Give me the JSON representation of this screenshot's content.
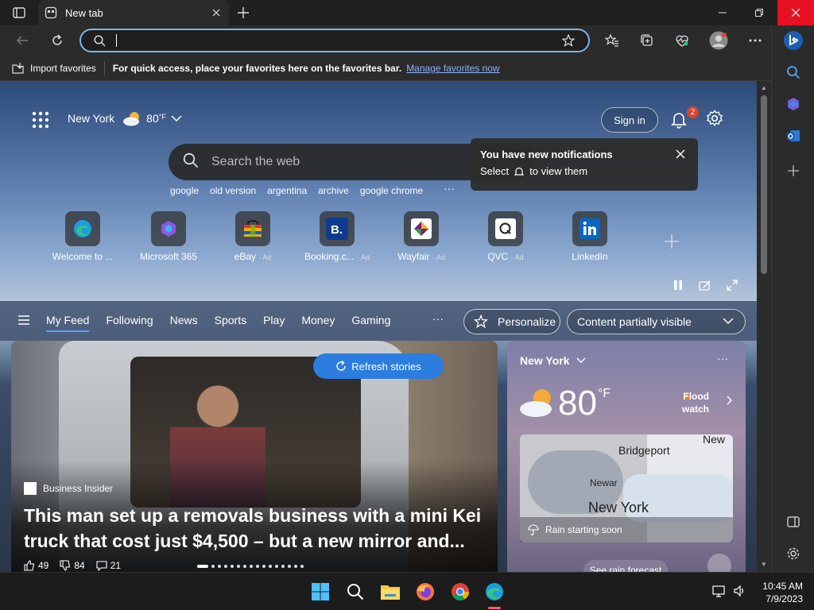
{
  "window": {
    "tab_title": "New tab",
    "close_color": "#e81123"
  },
  "address": {
    "value": "",
    "placeholder": ""
  },
  "favorites_bar": {
    "import_label": "Import favorites",
    "message": "For quick access, place your favorites here on the favorites bar.",
    "manage_link": "Manage favorites now"
  },
  "newtab": {
    "location": "New York",
    "temp": "80",
    "temp_unit": "°F",
    "sign_in": "Sign in",
    "notification_count": "2",
    "search_placeholder": "Search the web",
    "trending": [
      "google",
      "old version",
      "argentina",
      "archive",
      "google chrome"
    ],
    "trending_more": "···",
    "notification": {
      "title": "You have new notifications",
      "sub_prefix": "Select",
      "sub_suffix": "to view them"
    },
    "tiles": [
      {
        "label": "Welcome to ...",
        "ad": "",
        "icon": "edge-icon"
      },
      {
        "label": "Microsoft 365",
        "ad": "",
        "icon": "m365-icon"
      },
      {
        "label": "eBay",
        "ad": "· Ad",
        "icon": "ebay-icon"
      },
      {
        "label": "Booking.c...",
        "ad": "· Ad",
        "icon": "booking-icon"
      },
      {
        "label": "Wayfair",
        "ad": "· Ad",
        "icon": "wayfair-icon"
      },
      {
        "label": "QVC",
        "ad": "· Ad",
        "icon": "qvc-icon"
      },
      {
        "label": "LinkedIn",
        "ad": "",
        "icon": "linkedin-icon"
      }
    ]
  },
  "feed": {
    "tabs": [
      "My Feed",
      "Following",
      "News",
      "Sports",
      "Play",
      "Money",
      "Gaming"
    ],
    "active_tab": "My Feed",
    "more": "···",
    "personalize": "Personalize",
    "content_visibility": "Content partially visible",
    "accent": "#2b7de0"
  },
  "hero": {
    "refresh": "Refresh stories",
    "source": "Business Insider",
    "title": "This man set up a removals business with a mini Kei truck that cost just $4,500 – but a new mirror and...",
    "likes": "49",
    "dislikes": "84",
    "comments": "21"
  },
  "weather_card": {
    "location": "New York",
    "temp": "80",
    "unit": "°F",
    "alert_line1": "Flood",
    "alert_line2": "watch",
    "map_labels": {
      "new": "New",
      "bridgeport": "Bridgeport",
      "newark": "Newar",
      "newyork": "New York"
    },
    "rain": "Rain starting soon",
    "forecast": "See rain forecast",
    "more": "···"
  },
  "taskbar": {
    "time": "10:45 AM",
    "date": "7/9/2023"
  }
}
